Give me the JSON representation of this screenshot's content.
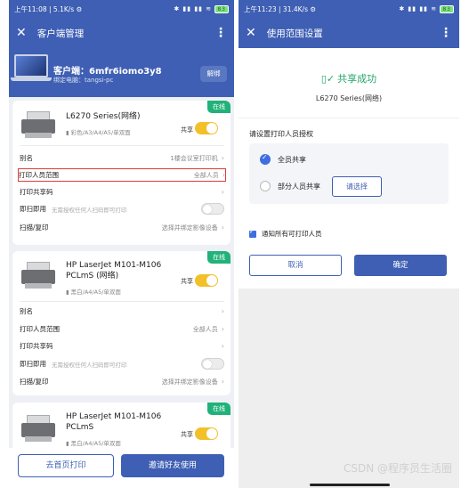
{
  "left": {
    "status": {
      "time": "上午11:08",
      "speed": "5.1K/s",
      "battery": "83"
    },
    "appbar": {
      "title": "客户端管理"
    },
    "client": {
      "name": "客户端：6mfr6iomo3y8",
      "bound": "绑定电脑：tangsi-pc",
      "unbind": "解绑"
    },
    "printers": [
      {
        "badge": "在线",
        "name_line1": "L6270 Series(网络)",
        "name_line2": "",
        "spec": "彩色/A3/A4/A5/单双面",
        "share": "共享",
        "rows": {
          "alias": "别名",
          "alias_value": "1楼会议室打印机",
          "scope": "打印人员范围",
          "scope_value": "全部人员",
          "code": "打印共享码",
          "instant": "即扫即用",
          "instant_hint": "无需授权任何人扫码即可打印",
          "scan": "扫描/复印",
          "scan_value": "选择并绑定影像设备"
        }
      },
      {
        "badge": "在线",
        "name_line1": "HP LaserJet M101-M106",
        "name_line2": "PCLmS (网络)",
        "spec": "黑白/A4/A5/单双面",
        "share": "共享",
        "rows": {
          "alias": "别名",
          "alias_value": "",
          "scope": "打印人员范围",
          "scope_value": "全部人员",
          "code": "打印共享码",
          "instant": "即扫即用",
          "instant_hint": "无需授权任何人扫码即可打印",
          "scan": "扫描/复印",
          "scan_value": "选择并绑定影像设备"
        }
      },
      {
        "badge": "在线",
        "name_line1": "HP LaserJet M101-M106",
        "name_line2": "PCLmS",
        "spec": "黑白/A4/A5/单双面",
        "share": "共享"
      }
    ],
    "bottom": {
      "home_print": "去首页打印",
      "invite": "邀请好友使用"
    }
  },
  "right": {
    "status": {
      "time": "上午11:23",
      "speed": "31.4K/s",
      "battery": "83"
    },
    "appbar": {
      "title": "使用范围设置"
    },
    "success": "共享成功",
    "model": "L6270 Series(网络)",
    "auth_label": "请设置打印人员授权",
    "option_all": "全员共享",
    "option_partial": "部分人员共享",
    "select_button": "请选择",
    "notify_label": "通知所有可打印人员",
    "cancel": "取消",
    "confirm": "确定"
  },
  "watermark": "CSDN @程序员生活圈",
  "colors": {
    "primary": "#3e5fb3",
    "online": "#21b27a",
    "toggle_on": "#f2c028",
    "success": "#23a56a",
    "highlight": "#e23a3a"
  }
}
